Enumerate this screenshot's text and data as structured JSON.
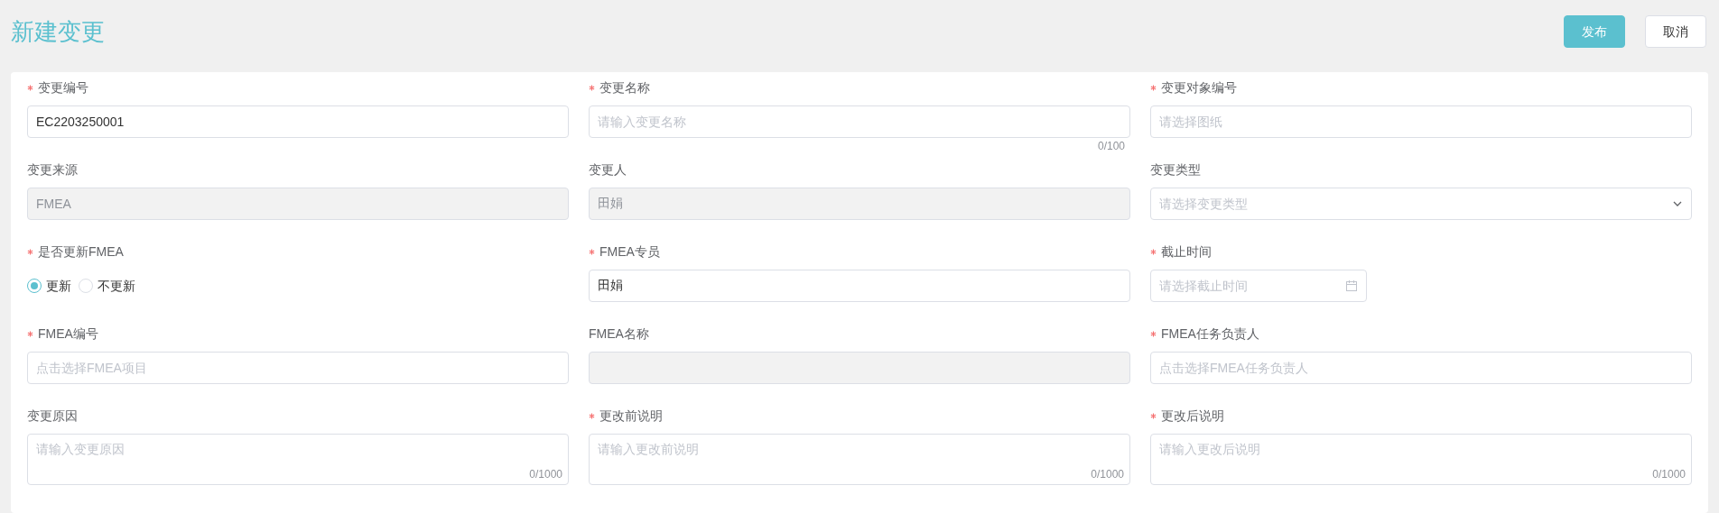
{
  "title": "新建变更",
  "buttons": [
    {
      "label": "发布",
      "kind": "primary"
    },
    {
      "label": "取消",
      "kind": "default"
    }
  ],
  "fields": [
    {
      "kind": "text",
      "label": "变更编号",
      "required": true,
      "value": "EC2203250001"
    },
    {
      "kind": "text",
      "label": "变更名称",
      "required": true,
      "placeholder": "请输入变更名称",
      "counter": "0/100"
    },
    {
      "kind": "text",
      "label": "变更对象编号",
      "required": true,
      "placeholder": "请选择图纸"
    },
    {
      "kind": "disabled",
      "label": "变更来源",
      "required": false,
      "value": "FMEA"
    },
    {
      "kind": "disabled",
      "label": "变更人",
      "required": false,
      "value": "田娟"
    },
    {
      "kind": "select",
      "label": "变更类型",
      "required": false,
      "placeholder": "请选择变更类型"
    },
    {
      "kind": "radio",
      "label": "是否更新FMEA",
      "required": true,
      "options": [
        {
          "label": "更新",
          "selected": true
        },
        {
          "label": "不更新",
          "selected": false
        }
      ]
    },
    {
      "kind": "text",
      "label": "FMEA专员",
      "required": true,
      "value": "田娟"
    },
    {
      "kind": "date",
      "label": "截止时间",
      "required": true,
      "placeholder": "请选择截止时间"
    },
    {
      "kind": "text",
      "label": "FMEA编号",
      "required": true,
      "placeholder": "点击选择FMEA项目"
    },
    {
      "kind": "disabled",
      "label": "FMEA名称",
      "required": false
    },
    {
      "kind": "text",
      "label": "FMEA任务负责人",
      "required": true,
      "placeholder": "点击选择FMEA任务负责人"
    },
    {
      "kind": "textarea",
      "label": "变更原因",
      "required": false,
      "placeholder": "请输入变更原因",
      "counter": "0/1000"
    },
    {
      "kind": "textarea",
      "label": "更改前说明",
      "required": true,
      "placeholder": "请输入更改前说明",
      "counter": "0/1000"
    },
    {
      "kind": "textarea",
      "label": "更改后说明",
      "required": true,
      "placeholder": "请输入更改后说明",
      "counter": "0/1000"
    }
  ]
}
